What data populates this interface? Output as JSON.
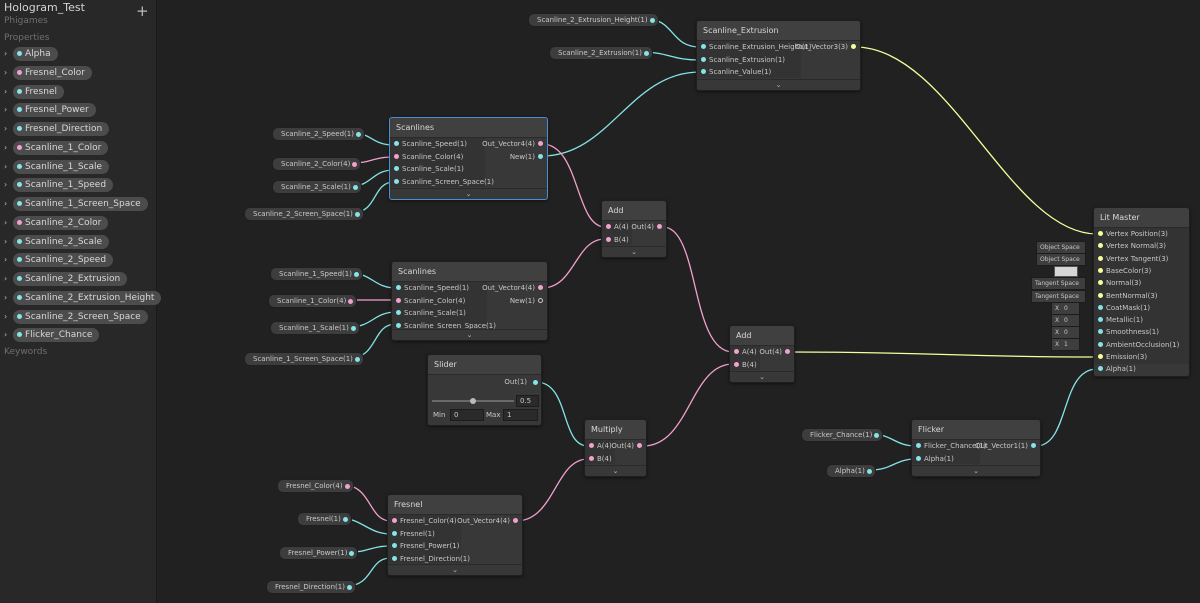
{
  "blackboard": {
    "title": "Hologram_Test",
    "subtitle": "Phigames",
    "add_icon": "plus-icon",
    "properties_label": "Properties",
    "keywords_label": "Keywords",
    "properties": [
      {
        "name": "Alpha",
        "color": "cyan"
      },
      {
        "name": "Fresnel_Color",
        "color": "pink"
      },
      {
        "name": "Fresnel",
        "color": "cyan"
      },
      {
        "name": "Fresnel_Power",
        "color": "cyan"
      },
      {
        "name": "Fresnel_Direction",
        "color": "cyan"
      },
      {
        "name": "Scanline_1_Color",
        "color": "pink"
      },
      {
        "name": "Scanline_1_Scale",
        "color": "cyan"
      },
      {
        "name": "Scanline_1_Speed",
        "color": "cyan"
      },
      {
        "name": "Scanline_1_Screen_Space",
        "color": "cyan"
      },
      {
        "name": "Scanline_2_Color",
        "color": "pink"
      },
      {
        "name": "Scanline_2_Scale",
        "color": "cyan"
      },
      {
        "name": "Scanline_2_Speed",
        "color": "cyan"
      },
      {
        "name": "Scanline_2_Extrusion",
        "color": "cyan"
      },
      {
        "name": "Scanline_2_Extrusion_Height",
        "color": "cyan"
      },
      {
        "name": "Scanline_2_Screen_Space",
        "color": "cyan"
      },
      {
        "name": "Flicker_Chance",
        "color": "cyan"
      }
    ]
  },
  "props": {
    "s2_ext_height": "Scanline_2_Extrusion_Height(1)",
    "s2_ext": "Scanline_2_Extrusion(1)",
    "s2_speed": "Scanline_2_Speed(1)",
    "s2_color": "Scanline_2_Color(4)",
    "s2_scale": "Scanline_2_Scale(1)",
    "s2_screen": "Scanline_2_Screen_Space(1)",
    "s1_speed": "Scanline_1_Speed(1)",
    "s1_color": "Scanline_1_Color(4)",
    "s1_scale": "Scanline_1_Scale(1)",
    "s1_screen": "Scanline_1_Screen_Space(1)",
    "fresnel_color": "Fresnel_Color(4)",
    "fresnel": "Fresnel(1)",
    "fresnel_power": "Fresnel_Power(1)",
    "fresnel_direction": "Fresnel_Direction(1)",
    "flicker_chance": "Flicker_Chance(1)",
    "alpha": "Alpha(1)"
  },
  "nodes": {
    "scanline_extrusion": {
      "title": "Scanline_Extrusion",
      "inputs": [
        "Scanline_Extrusion_Height(1)",
        "Scanline_Extrusion(1)",
        "Scanline_Value(1)"
      ],
      "outputs": [
        "Out_Vector3(3)"
      ]
    },
    "scanlines_top": {
      "title": "Scanlines",
      "inputs": [
        "Scanline_Speed(1)",
        "Scanline_Color(4)",
        "Scanline_Scale(1)",
        "Scanline_Screen_Space(1)"
      ],
      "outputs": [
        "Out_Vector4(4)",
        "New(1)"
      ]
    },
    "scanlines_bottom": {
      "title": "Scanlines",
      "inputs": [
        "Scanline_Speed(1)",
        "Scanline_Color(4)",
        "Scanline_Scale(1)",
        "Scanline_Screen_Space(1)"
      ],
      "outputs": [
        "Out_Vector4(4)",
        "New(1)"
      ]
    },
    "add_top": {
      "title": "Add",
      "inputs": [
        "A(4)",
        "B(4)"
      ],
      "outputs": [
        "Out(4)"
      ]
    },
    "add_bottom": {
      "title": "Add",
      "inputs": [
        "A(4)",
        "B(4)"
      ],
      "outputs": [
        "Out(4)"
      ]
    },
    "multiply": {
      "title": "Multiply",
      "inputs": [
        "A(4)",
        "B(4)"
      ],
      "outputs": [
        "Out(4)"
      ]
    },
    "slider": {
      "title": "Slider",
      "output": "Out(1)",
      "value": "0.5",
      "min_label": "Min",
      "min": "0",
      "max_label": "Max",
      "max": "1",
      "fraction": 0.5
    },
    "fresnel": {
      "title": "Fresnel",
      "inputs": [
        "Fresnel_Color(4)",
        "Fresnel(1)",
        "Fresnel_Power(1)",
        "Fresnel_Direction(1)"
      ],
      "outputs": [
        "Out_Vector4(4)"
      ]
    },
    "flicker": {
      "title": "Flicker",
      "inputs": [
        "Flicker_Chance(1)",
        "Alpha(1)"
      ],
      "outputs": [
        "Out_Vector1(1)"
      ]
    },
    "lit_master": {
      "title": "Lit Master",
      "inputs": [
        "Vertex Position(3)",
        "Vertex Normal(3)",
        "Vertex Tangent(3)",
        "BaseColor(3)",
        "Normal(3)",
        "BentNormal(3)",
        "CoatMask(1)",
        "Metallic(1)",
        "Smoothness(1)",
        "AmbientOcclusion(1)",
        "Emission(3)",
        "Alpha(1)"
      ],
      "defaults": {
        "vertex_normal": "Object Space",
        "vertex_tangent": "Object Space",
        "normal": "Tangent Space",
        "bent_normal": "Tangent Space",
        "coat_mask_x": "X",
        "coat_mask": "0",
        "metallic_x": "X",
        "metallic": "0",
        "smoothness_x": "X",
        "smoothness": "0",
        "ao_x": "X",
        "ao": "1",
        "base_color": "#d6d6d6"
      }
    }
  },
  "colors": {
    "float_wire": "#84e4e7",
    "vector4_wire": "#f2a0cd",
    "vector3_wire": "#f6ff9a",
    "selection": "#4a8fd1",
    "canvas": "#212121"
  },
  "footer_icon": "chevron-down-icon"
}
